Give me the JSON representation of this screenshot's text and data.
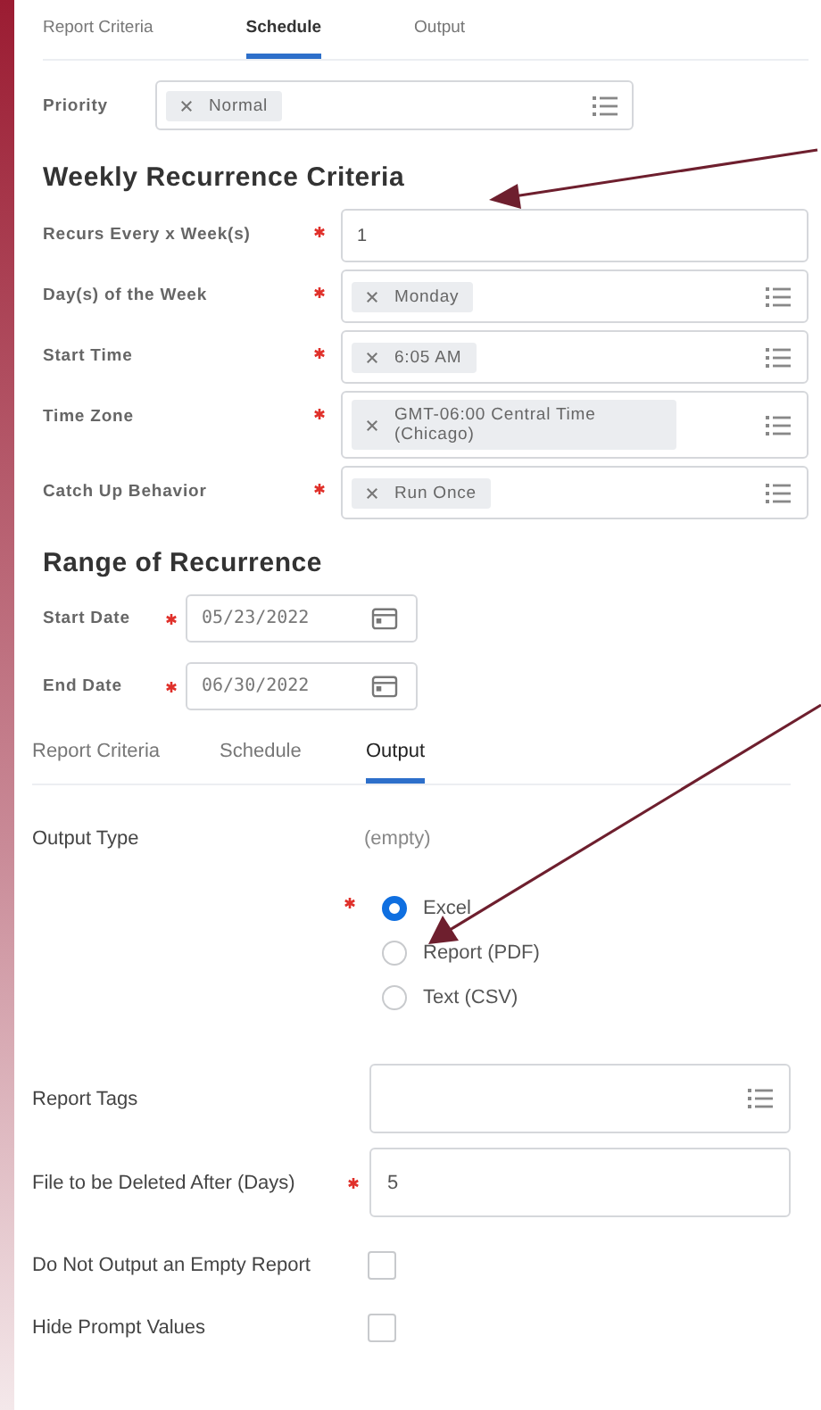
{
  "schedule_panel": {
    "tabs": [
      {
        "label": "Report Criteria",
        "selected": false
      },
      {
        "label": "Schedule",
        "selected": true
      },
      {
        "label": "Output",
        "selected": false
      }
    ],
    "priority": {
      "label": "Priority",
      "chips": [
        "Normal"
      ]
    },
    "heading": "Weekly Recurrence Criteria",
    "fields": [
      {
        "label": "Recurs Every x Week(s)",
        "kind": "text",
        "required": true,
        "value": "1"
      },
      {
        "label": "Day(s) of the Week",
        "kind": "select",
        "required": true,
        "chips": [
          "Monday"
        ]
      },
      {
        "label": "Start Time",
        "kind": "select",
        "required": true,
        "chips": [
          "6:05 AM"
        ]
      },
      {
        "label": "Time Zone",
        "kind": "select",
        "required": true,
        "chips": [
          "GMT-06:00 Central Time (Chicago)"
        ]
      },
      {
        "label": "Catch Up Behavior",
        "kind": "select",
        "required": true,
        "chips": [
          "Run Once"
        ]
      }
    ],
    "range_heading": "Range of Recurrence",
    "dates": [
      {
        "label": "Start Date",
        "required": true,
        "value": "05/23/2022"
      },
      {
        "label": "End Date",
        "required": true,
        "value": "06/30/2022"
      }
    ]
  },
  "output_panel": {
    "tabs": [
      {
        "label": "Report Criteria",
        "selected": false
      },
      {
        "label": "Schedule",
        "selected": false
      },
      {
        "label": "Output",
        "selected": true
      }
    ],
    "output_type": {
      "label": "Output Type",
      "value": "(empty)",
      "required": true
    },
    "format_options": [
      {
        "label": "Excel",
        "selected": true
      },
      {
        "label": "Report (PDF)",
        "selected": false
      },
      {
        "label": "Text (CSV)",
        "selected": false
      }
    ],
    "fields": [
      {
        "label": "Report Tags",
        "kind": "select",
        "required": false
      },
      {
        "label": "File to be Deleted After (Days)",
        "kind": "text",
        "required": true,
        "value": "5"
      }
    ],
    "checkboxes": [
      {
        "label": "Do Not Output an Empty Report",
        "checked": false
      },
      {
        "label": "Hide Prompt Values",
        "checked": false
      }
    ]
  }
}
